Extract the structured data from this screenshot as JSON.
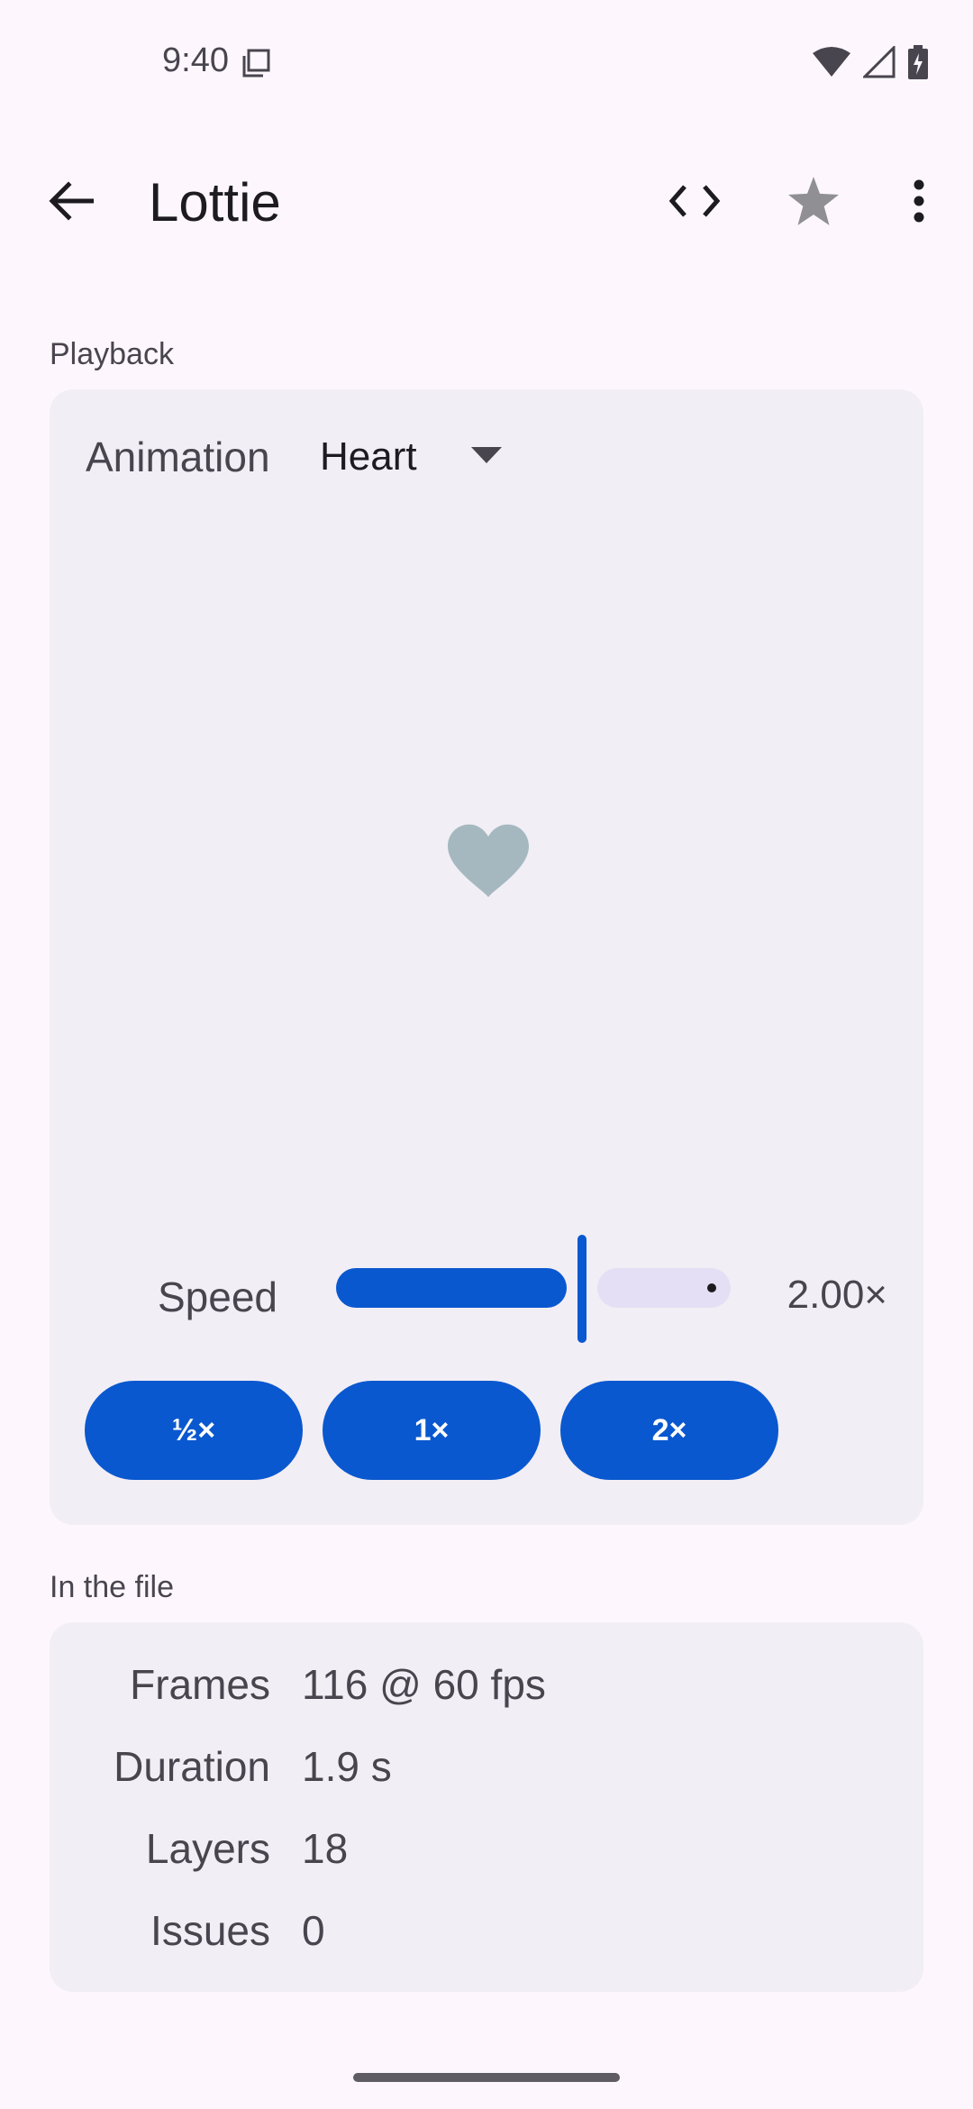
{
  "status_bar": {
    "time": "9:40",
    "icons": [
      "copy-icon",
      "wifi-icon",
      "signal-icon",
      "battery-charging-icon"
    ]
  },
  "app_bar": {
    "title": "Lottie",
    "icons": [
      "back-arrow-icon",
      "code-icon",
      "star-icon",
      "more-vert-icon"
    ]
  },
  "playback": {
    "section_label": "Playback",
    "animation_label": "Animation",
    "animation_value": "Heart",
    "preview_icon": "heart-icon",
    "speed_label": "Speed",
    "speed_value": "2.00×",
    "speed_fraction": 0.75,
    "presets": [
      {
        "label": "½×"
      },
      {
        "label": "1×"
      },
      {
        "label": "2×"
      }
    ]
  },
  "file_info": {
    "section_label": "In the file",
    "rows": [
      {
        "key": "Frames",
        "value": "116 @ 60 fps"
      },
      {
        "key": "Duration",
        "value": "1.9 s"
      },
      {
        "key": "Layers",
        "value": "18"
      },
      {
        "key": "Issues",
        "value": "0"
      }
    ]
  },
  "colors": {
    "background": "#fdf7fd",
    "card": "#f2eef5",
    "accent": "#0a58cf",
    "heart": "#a5b8c0"
  }
}
